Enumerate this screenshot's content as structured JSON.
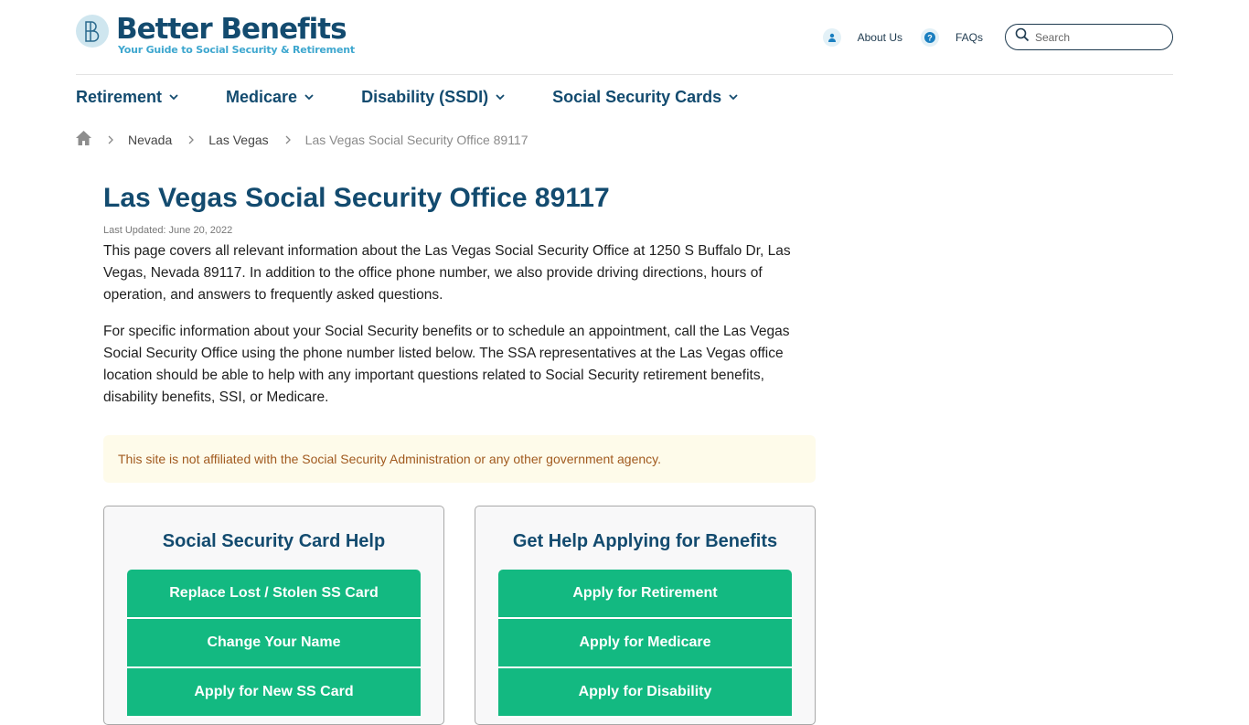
{
  "header": {
    "logo_title": "Better Benefits",
    "logo_tagline": "Your Guide to Social Security & Retirement",
    "links": [
      {
        "label": "About Us",
        "icon": "user-icon"
      },
      {
        "label": "FAQs",
        "icon": "question-icon"
      }
    ],
    "search_placeholder": "Search"
  },
  "nav": [
    {
      "label": "Retirement"
    },
    {
      "label": "Medicare"
    },
    {
      "label": "Disability (SSDI)"
    },
    {
      "label": "Social Security Cards"
    }
  ],
  "breadcrumb": [
    {
      "label": "Nevada"
    },
    {
      "label": "Las Vegas"
    },
    {
      "label": "Las Vegas Social Security Office 89117"
    }
  ],
  "main": {
    "title": "Las Vegas Social Security Office 89117",
    "last_updated": "Last Updated: June 20, 2022",
    "paragraphs": [
      "This page covers all relevant information about the Las Vegas Social Security Office at 1250 S Buffalo Dr, Las Vegas, Nevada 89117. In addition to the office phone number, we also provide driving directions, hours of operation, and answers to frequently asked questions.",
      "For specific information about your Social Security benefits or to schedule an appointment, call the Las Vegas Social Security Office using the phone number listed below. The SSA representatives at the Las Vegas office location should be able to help with any important questions related to Social Security retirement benefits, disability benefits, SSI, or Medicare."
    ],
    "notice": "This site is not affiliated with the Social Security Administration or any other government agency."
  },
  "cards": [
    {
      "title": "Social Security Card Help",
      "buttons": [
        "Replace Lost / Stolen SS Card",
        "Change Your Name",
        "Apply for New SS Card"
      ]
    },
    {
      "title": "Get Help Applying for Benefits",
      "buttons": [
        "Apply for Retirement",
        "Apply for Medicare",
        "Apply for Disability"
      ]
    }
  ],
  "colors": {
    "brand": "#134b6f",
    "accent": "#13b981",
    "notice_bg": "#fefbea",
    "notice_text": "#a15a1f"
  }
}
